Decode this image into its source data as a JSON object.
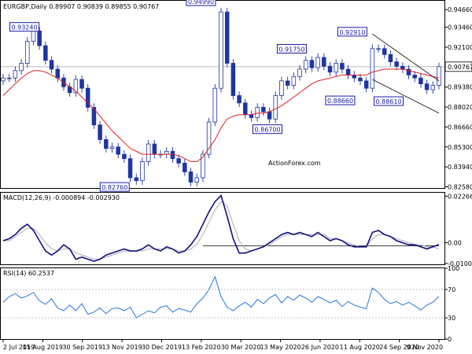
{
  "chart_data": [
    {
      "type": "candlestick",
      "panel": "price",
      "title": "EURGBP,Daily  0.89907 0.90839 0.89855 0.90767",
      "ohlc": {
        "open": 0.89907,
        "high": 0.90839,
        "low": 0.89855,
        "close": 0.90767
      },
      "last_price_label": "0.90767",
      "ylim": [
        0.825,
        0.951
      ],
      "y_ticks": [
        "0.94660",
        "0.93460",
        "0.92100",
        "0.90767",
        "0.89380",
        "0.88020",
        "0.86660",
        "0.85300",
        "0.83940",
        "0.82580"
      ],
      "x_ticks": [
        "2 Jul 2019",
        "15 Aug 2019",
        "30 Sep 2019",
        "13 Nov 2019",
        "30 Dec 2019",
        "13 Feb 2020",
        "30 Mar 2020",
        "13 May 2020",
        "26 Jun 2020",
        "11 Aug 2020",
        "24 Sep 2020",
        "9 Nov 2020"
      ],
      "annotations": [
        {
          "label": "0.93240",
          "value": 0.9324
        },
        {
          "label": "0.82760",
          "value": 0.8276
        },
        {
          "label": "0.94990",
          "value": 0.9499
        },
        {
          "label": "0.86700",
          "value": 0.867
        },
        {
          "label": "0.91750",
          "value": 0.9175
        },
        {
          "label": "0.92910",
          "value": 0.9291
        },
        {
          "label": "0.88660",
          "value": 0.8866
        },
        {
          "label": "0.88610",
          "value": 0.8861
        }
      ],
      "series": [
        {
          "name": "Close",
          "values": [
            0.9,
            0.9,
            0.905,
            0.91,
            0.925,
            0.932,
            0.922,
            0.912,
            0.906,
            0.9,
            0.894,
            0.89,
            0.899,
            0.893,
            0.88,
            0.868,
            0.858,
            0.852,
            0.853,
            0.848,
            0.845,
            0.832,
            0.83,
            0.843,
            0.855,
            0.848,
            0.848,
            0.85,
            0.845,
            0.842,
            0.836,
            0.829,
            0.832,
            0.848,
            0.87,
            0.893,
            0.945,
            0.91,
            0.888,
            0.883,
            0.875,
            0.873,
            0.88,
            0.877,
            0.872,
            0.888,
            0.898,
            0.895,
            0.901,
            0.906,
            0.912,
            0.907,
            0.914,
            0.908,
            0.904,
            0.91,
            0.906,
            0.902,
            0.9,
            0.898,
            0.893,
            0.92,
            0.92,
            0.916,
            0.911,
            0.908,
            0.906,
            0.902,
            0.9,
            0.896,
            0.892,
            0.895,
            0.9077
          ]
        },
        {
          "name": "MA",
          "values": [
            0.888,
            0.892,
            0.896,
            0.9,
            0.903,
            0.905,
            0.905,
            0.904,
            0.902,
            0.9,
            0.897,
            0.894,
            0.891,
            0.887,
            0.883,
            0.879,
            0.874,
            0.869,
            0.864,
            0.86,
            0.856,
            0.852,
            0.85,
            0.848,
            0.848,
            0.848,
            0.848,
            0.848,
            0.848,
            0.847,
            0.845,
            0.843,
            0.843,
            0.846,
            0.852,
            0.858,
            0.866,
            0.872,
            0.874,
            0.875,
            0.875,
            0.875,
            0.876,
            0.876,
            0.877,
            0.879,
            0.881,
            0.884,
            0.887,
            0.89,
            0.893,
            0.896,
            0.898,
            0.899,
            0.9,
            0.901,
            0.902,
            0.902,
            0.902,
            0.902,
            0.902,
            0.904,
            0.905,
            0.906,
            0.906,
            0.906,
            0.906,
            0.905,
            0.904,
            0.903,
            0.902,
            0.901,
            0.9
          ]
        }
      ]
    },
    {
      "type": "line",
      "panel": "macd",
      "title": "MACD(12,26,9) -0.000894 -0.002930",
      "ylim": [
        -0.0105,
        0.0232
      ],
      "y_ticks": [
        "0.022662",
        "0.00",
        "-0.010052"
      ],
      "series": [
        {
          "name": "MACD",
          "values": [
            0.001,
            0.002,
            0.004,
            0.007,
            0.009,
            0.006,
            0.001,
            -0.004,
            -0.006,
            -0.004,
            -0.001,
            -0.003,
            -0.008,
            -0.007,
            -0.008,
            -0.009,
            -0.008,
            -0.006,
            -0.005,
            -0.004,
            -0.003,
            -0.004,
            -0.004,
            -0.003,
            -0.001,
            -0.003,
            -0.004,
            -0.002,
            -0.003,
            -0.005,
            -0.004,
            -0.001,
            0.003,
            0.009,
            0.015,
            0.02,
            0.023,
            0.013,
            0.002,
            -0.005,
            -0.005,
            -0.004,
            -0.003,
            -0.002,
            0.0,
            0.002,
            0.004,
            0.005,
            0.004,
            0.005,
            0.004,
            0.003,
            0.005,
            0.003,
            0.001,
            0.002,
            0.001,
            -0.001,
            -0.002,
            -0.002,
            -0.002,
            0.005,
            0.006,
            0.004,
            0.003,
            0.001,
            0.0,
            -0.001,
            -0.001,
            -0.002,
            -0.003,
            -0.002,
            -0.0009
          ]
        },
        {
          "name": "Signal",
          "values": [
            0.001,
            0.001,
            0.003,
            0.005,
            0.007,
            0.007,
            0.004,
            0.0,
            -0.003,
            -0.004,
            -0.003,
            -0.003,
            -0.005,
            -0.006,
            -0.007,
            -0.008,
            -0.008,
            -0.007,
            -0.006,
            -0.005,
            -0.004,
            -0.004,
            -0.004,
            -0.004,
            -0.003,
            -0.003,
            -0.003,
            -0.003,
            -0.003,
            -0.004,
            -0.004,
            -0.003,
            -0.001,
            0.004,
            0.01,
            0.016,
            0.02,
            0.018,
            0.009,
            0.001,
            -0.003,
            -0.004,
            -0.003,
            -0.002,
            -0.001,
            0.001,
            0.003,
            0.004,
            0.004,
            0.004,
            0.004,
            0.004,
            0.004,
            0.004,
            0.002,
            0.002,
            0.001,
            0.0,
            -0.001,
            -0.002,
            -0.002,
            0.002,
            0.004,
            0.004,
            0.003,
            0.002,
            0.001,
            0.0,
            -0.001,
            -0.001,
            -0.002,
            -0.002,
            -0.0029
          ]
        }
      ],
      "zero_line": -0.0015
    },
    {
      "type": "line",
      "panel": "rsi",
      "title": "RSI(14) 60.2537",
      "ylim": [
        0,
        100
      ],
      "y_ticks": [
        "100",
        "70",
        "30",
        "0"
      ],
      "series": [
        {
          "name": "RSI",
          "values": [
            52,
            60,
            64,
            58,
            61,
            66,
            54,
            49,
            57,
            44,
            40,
            48,
            40,
            50,
            35,
            38,
            44,
            36,
            43,
            44,
            40,
            45,
            30,
            35,
            40,
            37,
            45,
            47,
            38,
            43,
            41,
            38,
            50,
            58,
            70,
            88,
            60,
            45,
            40,
            47,
            52,
            45,
            56,
            50,
            58,
            63,
            51,
            60,
            55,
            62,
            58,
            52,
            60,
            56,
            51,
            55,
            46,
            53,
            48,
            45,
            43,
            72,
            66,
            56,
            50,
            53,
            48,
            52,
            47,
            41,
            48,
            52,
            60.25
          ]
        }
      ]
    }
  ],
  "watermark": "ActionForex.com",
  "colors": {
    "candle": "#1f35a0",
    "ma": "#e02020",
    "macd": "#101080",
    "signal": "#b8b8b8",
    "rsi": "#2a74d6",
    "annotation": "#1a1aa6",
    "grid": "#b0b0b0"
  }
}
